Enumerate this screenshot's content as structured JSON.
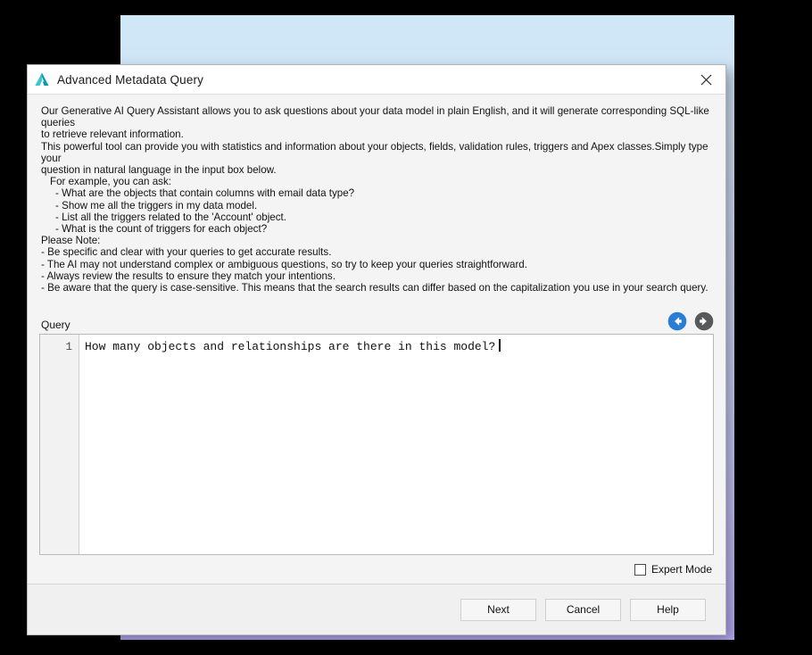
{
  "window": {
    "title": "Advanced Metadata Query",
    "icon": "app-triangle-icon",
    "close_icon": "close-icon"
  },
  "intro": {
    "lines": [
      {
        "text": "Our Generative AI Query Assistant allows you to ask questions about your data model in plain English, and it will generate corresponding SQL-like queries",
        "indent": 0
      },
      {
        "text": "to retrieve relevant information.",
        "indent": 0
      },
      {
        "text": "This powerful tool can provide you with statistics and information about your objects, fields, validation rules, triggers and Apex classes.Simply type your",
        "indent": 0
      },
      {
        "text": "question in natural language in the input box below.",
        "indent": 0
      },
      {
        "text": "For example, you can ask:",
        "indent": 1
      },
      {
        "text": "- What are the objects that contain columns with email data type?",
        "indent": 2
      },
      {
        "text": "- Show me all the triggers in my data model.",
        "indent": 2
      },
      {
        "text": "- List all the triggers related to the 'Account' object.",
        "indent": 2
      },
      {
        "text": "- What is the count of triggers for each object?",
        "indent": 2
      },
      {
        "text": "Please Note:",
        "indent": 0
      },
      {
        "text": "- Be specific and clear with your queries to get accurate results.",
        "indent": 0
      },
      {
        "text": "- The AI may not understand complex or ambiguous questions, so try to keep your queries straightforward.",
        "indent": 0
      },
      {
        "text": "- Always review the results to ensure they match your intentions.",
        "indent": 0
      },
      {
        "text": "- Be aware that the query is case-sensitive. This means that the search results can differ based on the capitalization you use in your search query.",
        "indent": 0
      }
    ]
  },
  "query_section": {
    "label": "Query",
    "back_icon": "arrow-left-circle-icon",
    "forward_icon": "arrow-right-circle-icon",
    "back_color": "#2b7cd3",
    "forward_color": "#58595b",
    "editor": {
      "line_numbers": [
        "1"
      ],
      "value": "How many objects and relationships are there in this model?",
      "placeholder": ""
    }
  },
  "expert_mode": {
    "label": "Expert Mode",
    "checked": false
  },
  "footer": {
    "buttons": [
      {
        "label": "Next",
        "name": "next-button"
      },
      {
        "label": "Cancel",
        "name": "cancel-button"
      },
      {
        "label": "Help",
        "name": "help-button"
      }
    ]
  },
  "backdrop": {
    "gradient_top": "#cfe8f7",
    "gradient_bottom": "#b9aef9"
  }
}
